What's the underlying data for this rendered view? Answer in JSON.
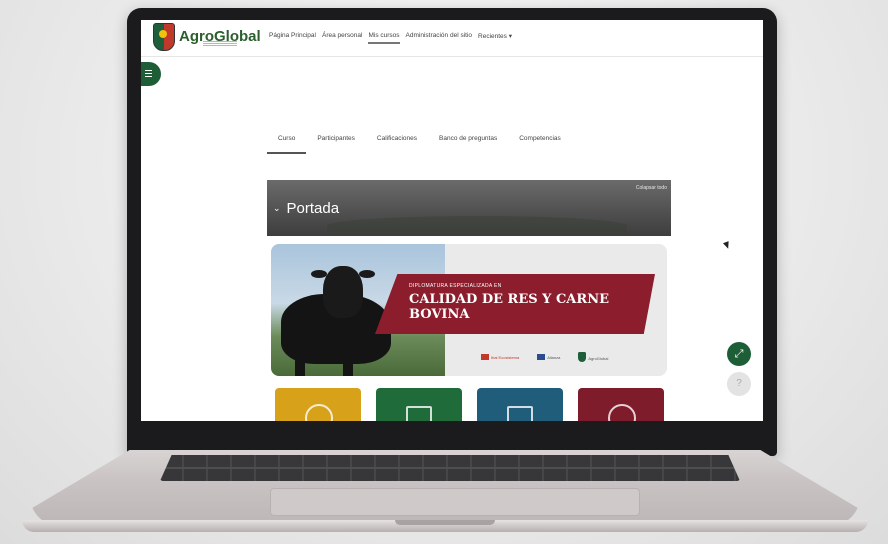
{
  "brand": {
    "name": "AgroGlobal"
  },
  "nav": {
    "items": [
      "Página Principal",
      "Área personal",
      "Mis cursos",
      "Administración del sitio",
      "Recientes"
    ],
    "active_index": 2
  },
  "tabs": {
    "items": [
      "Curso",
      "Participantes",
      "Calificaciones",
      "Banco de preguntas",
      "Competencias"
    ],
    "active_index": 0
  },
  "section": {
    "title": "Portada",
    "collapse_label": "Colapsar todo"
  },
  "banner": {
    "subtitle": "DIPLOMATURA ESPECIALIZADA EN",
    "title_line1": "CALIDAD DE RES Y CARNE",
    "title_line2": "BOVINA",
    "partners": [
      "Ibai Ecosistema",
      "Alianza",
      "AgroGlobal"
    ]
  },
  "tiles": {
    "colors": [
      "#d7a21a",
      "#1f6b3a",
      "#1f5d7a",
      "#7e1c2b"
    ]
  },
  "colors": {
    "brand_green": "#1d5e36",
    "accent_red": "#8b1d2c"
  }
}
